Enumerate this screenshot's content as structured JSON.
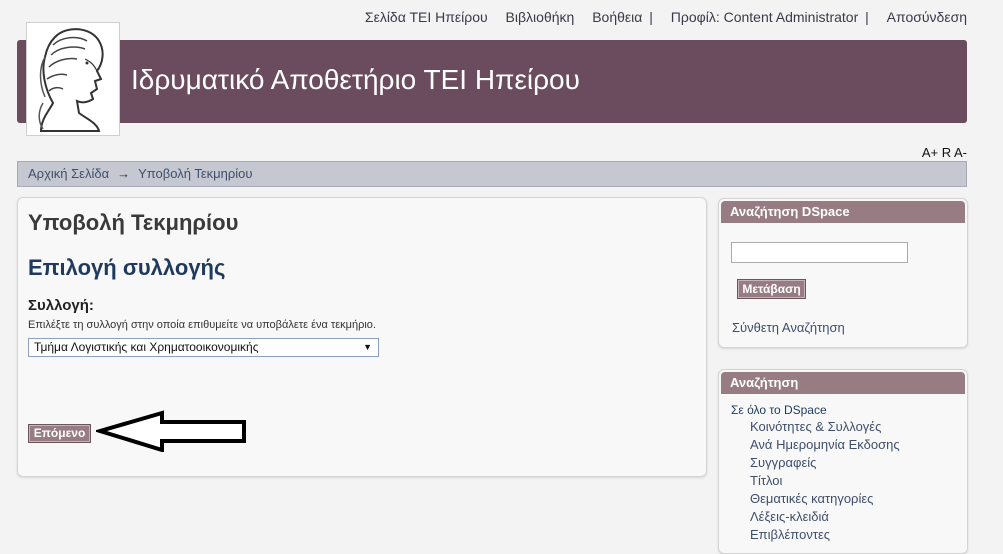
{
  "topnav": {
    "home": "Σελίδα ΤΕΙ Ηπείρου",
    "library": "Βιβλιοθήκη",
    "help": "Βοήθεια",
    "profile": "Προφίλ: Content Administrator",
    "logout": "Αποσύνδεση",
    "separator": "|"
  },
  "header": {
    "title": "Ιδρυματικό Αποθετήριο ΤΕΙ Ηπείρου"
  },
  "font_controls": {
    "increase": "A+",
    "reset": "R",
    "decrease": "A-"
  },
  "breadcrumb": {
    "home": "Αρχική Σελίδα",
    "arrow": "→",
    "current": "Υποβολή Τεκμηρίου"
  },
  "main": {
    "page_title": "Υποβολή Τεκμηρίου",
    "section_title": "Επιλογή συλλογής",
    "field_label": "Συλλογή:",
    "field_help": "Επιλέξτε τη συλλογή στην οποία επιθυμείτε να υποβάλετε ένα τεκμήριο.",
    "selected_collection": "Τμήμα Λογιστικής και Χρηματοοικονομικής",
    "select_caret": "▼",
    "next_button": "Επόμενο"
  },
  "sidebar": {
    "search_box": {
      "title": "Αναζήτηση DSpace",
      "go_button": "Μετάβαση",
      "advanced_link": "Σύνθετη Αναζήτηση"
    },
    "browse_box": {
      "title": "Αναζήτηση",
      "scope": "Σε όλο το DSpace",
      "items": [
        "Κοινότητες & Συλλογές",
        "Ανά Ημερομηνία Εκδοσης",
        "Συγγραφείς",
        "Τίτλοι",
        "Θεματικές κατηγορίες",
        "Λέξεις-κλειδιά",
        "Επιβλέποντες"
      ]
    }
  },
  "colors": {
    "banner": "#6b4b5e",
    "button": "#977c84",
    "breadcrumb_bar": "#c5c8d1",
    "link": "#3f4f6b"
  }
}
